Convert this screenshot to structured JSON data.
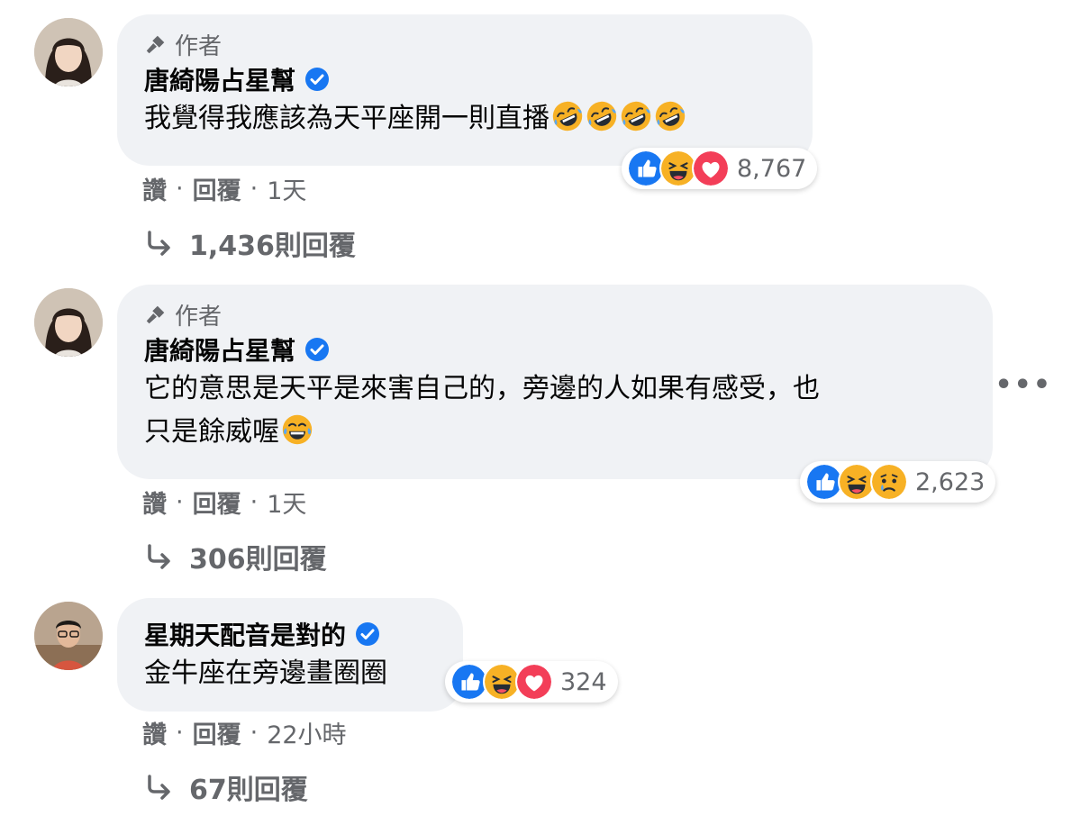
{
  "comments": [
    {
      "author_badge": "作者",
      "name": "唐綺陽占星幫",
      "text": "我覺得我應該為天平座開一則直播",
      "text_line2": "",
      "emojis": [
        "rofl-emoji",
        "rofl-emoji",
        "rofl-emoji",
        "rofl-emoji"
      ],
      "reactions": [
        "like",
        "haha",
        "love"
      ],
      "reaction_count": "8,767",
      "like_label": "讚",
      "reply_label": "回覆",
      "time": "1天",
      "replies_label": "1,436則回覆"
    },
    {
      "author_badge": "作者",
      "name": "唐綺陽占星幫",
      "text": "它的意思是天平是來害自己的，旁邊的人如果有感受，也",
      "text_line2": "只是餘威喔",
      "emojis": [
        "joy-emoji"
      ],
      "reactions": [
        "like",
        "haha",
        "sad"
      ],
      "reaction_count": "2,623",
      "like_label": "讚",
      "reply_label": "回覆",
      "time": "1天",
      "replies_label": "306則回覆",
      "more_label": "•••"
    },
    {
      "name": "星期天配音是對的",
      "text": "金牛座在旁邊畫圈圈",
      "reactions": [
        "like",
        "haha",
        "love"
      ],
      "reaction_count": "324",
      "like_label": "讚",
      "reply_label": "回覆",
      "time": "22小時",
      "replies_label": "67則回覆"
    }
  ],
  "colors": {
    "bubble_bg": "#f0f2f5",
    "verified": "#1877f2",
    "secondary_text": "#65676b",
    "like": "#1877f2",
    "love": "#f33e58",
    "haha": "#f7b125"
  }
}
